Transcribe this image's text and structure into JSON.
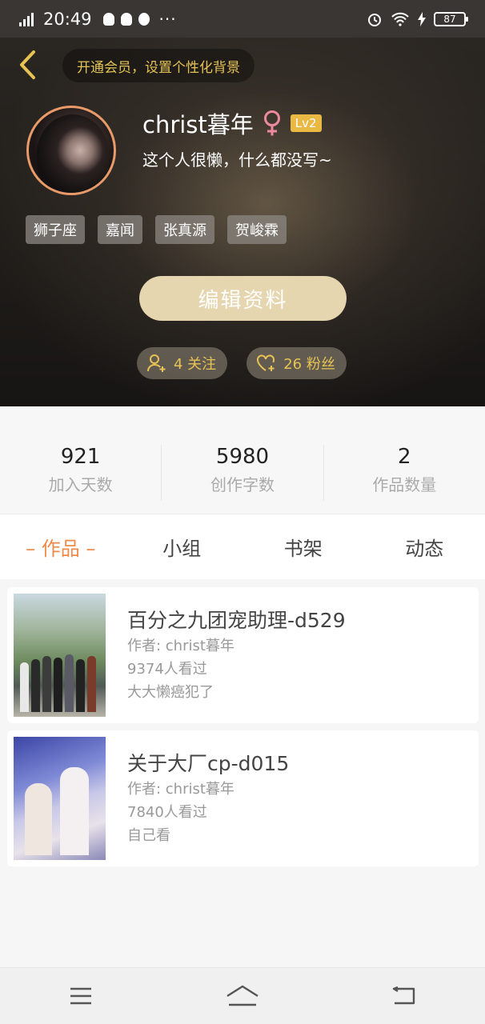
{
  "status_bar": {
    "network": "G",
    "time": "20:49",
    "more": "···",
    "battery": "87"
  },
  "header": {
    "vip_banner": "开通会员，设置个性化背景",
    "username": "christ暮年",
    "level": "Lv2",
    "bio": "这个人很懒，什么都没写~",
    "tags": [
      "狮子座",
      "嘉闻",
      "张真源",
      "贺峻霖"
    ],
    "edit_button": "编辑资料",
    "following": "4 关注",
    "followers": "26 粉丝",
    "accent_color": "#e7c353"
  },
  "stats": [
    {
      "value": "921",
      "label": "加入天数"
    },
    {
      "value": "5980",
      "label": "创作字数"
    },
    {
      "value": "2",
      "label": "作品数量"
    }
  ],
  "tabs": [
    {
      "label": "– 作品 –",
      "active": true
    },
    {
      "label": "小组",
      "active": false
    },
    {
      "label": "书架",
      "active": false
    },
    {
      "label": "动态",
      "active": false
    }
  ],
  "works": [
    {
      "title": "百分之九团宠助理-d529",
      "author": "作者: christ暮年",
      "views": "9374人看过",
      "note": "大大懒癌犯了"
    },
    {
      "title": "关于大厂cp-d015",
      "author": "作者: christ暮年",
      "views": "7840人看过",
      "note": "自己看"
    }
  ]
}
